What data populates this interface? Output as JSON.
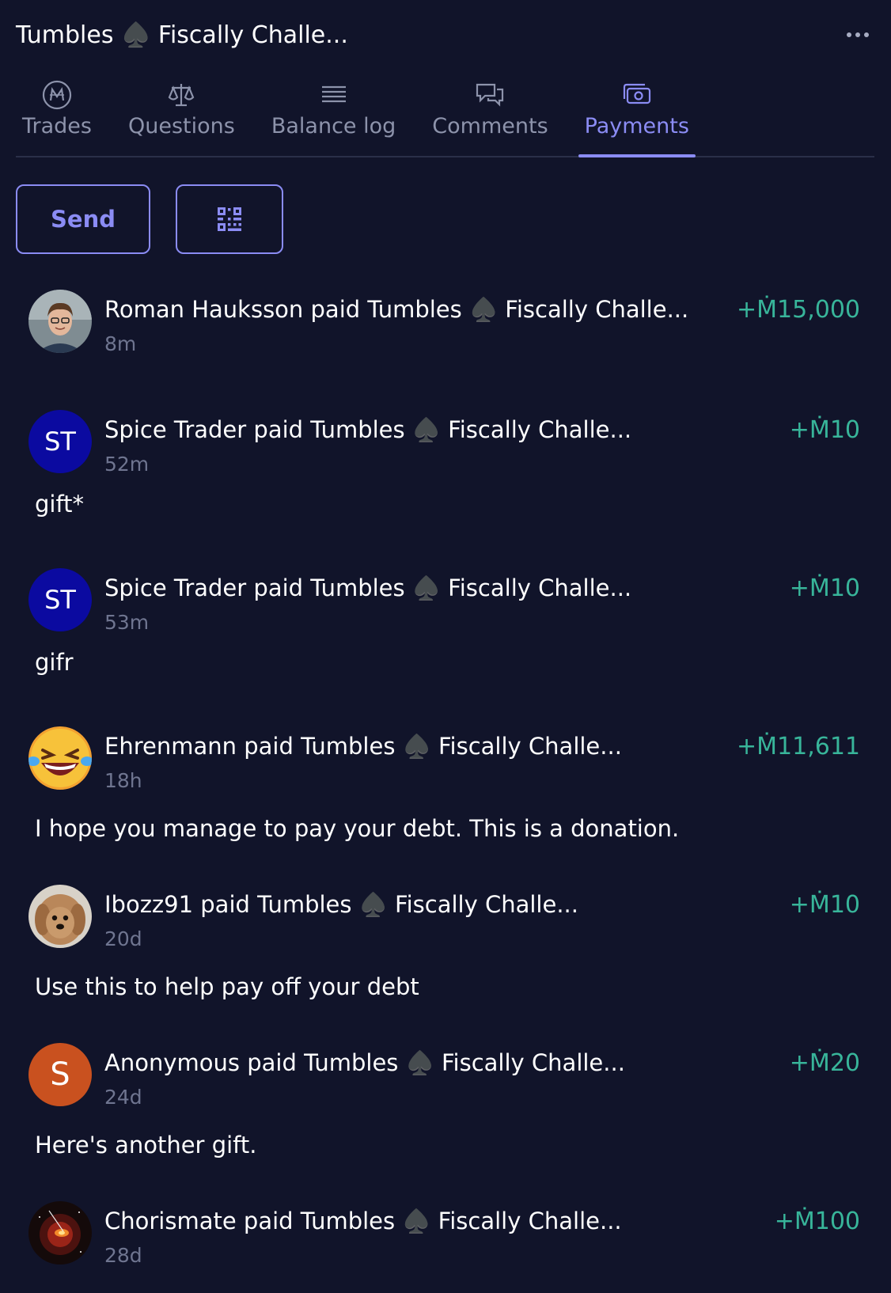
{
  "header": {
    "title": "Tumbles ♠️ Fiscally Challe..."
  },
  "tabs": [
    {
      "label": "Trades",
      "icon": "mana-coin-icon"
    },
    {
      "label": "Questions",
      "icon": "scale-icon"
    },
    {
      "label": "Balance log",
      "icon": "list-icon"
    },
    {
      "label": "Comments",
      "icon": "chat-bubbles-icon"
    },
    {
      "label": "Payments",
      "icon": "payments-icon",
      "active": true
    }
  ],
  "actions": {
    "send_label": "Send",
    "qr_icon": "qr-code-icon"
  },
  "colors": {
    "accent": "#8b8cf4",
    "positive": "#38b59a",
    "background": "#11142a"
  },
  "payments": [
    {
      "text": "Roman Hauksson paid Tumbles ♠️ Fiscally Challe...",
      "time": "8m",
      "amount": "+Ṁ15,000",
      "avatar": "photo-man-glasses"
    },
    {
      "text": "Spice Trader paid Tumbles ♠️ Fiscally Challe...",
      "time": "52m",
      "amount": "+Ṁ10",
      "avatar_initials": "ST",
      "note": "gift*"
    },
    {
      "text": "Spice Trader paid Tumbles ♠️ Fiscally Challe...",
      "time": "53m",
      "amount": "+Ṁ10",
      "avatar_initials": "ST",
      "note": "gifr"
    },
    {
      "text": "Ehrenmann paid Tumbles ♠️ Fiscally Challe...",
      "time": "18h",
      "amount": "+Ṁ11,611",
      "avatar": "laughing-emoji",
      "note": "I hope you manage to pay your debt. This is a donation."
    },
    {
      "text": "Ibozz91 paid Tumbles ♠️ Fiscally Challe...",
      "time": "20d",
      "amount": "+Ṁ10",
      "avatar": "photo-dog",
      "note": "Use this to help pay off your debt"
    },
    {
      "text": "Anonymous paid Tumbles ♠️ Fiscally Challe...",
      "time": "24d",
      "amount": "+Ṁ20",
      "avatar_initials": "S",
      "note": "Here's another gift."
    },
    {
      "text": "Chorismate paid Tumbles ♠️ Fiscally Challe...",
      "time": "28d",
      "amount": "+Ṁ100",
      "avatar": "photo-space"
    }
  ]
}
